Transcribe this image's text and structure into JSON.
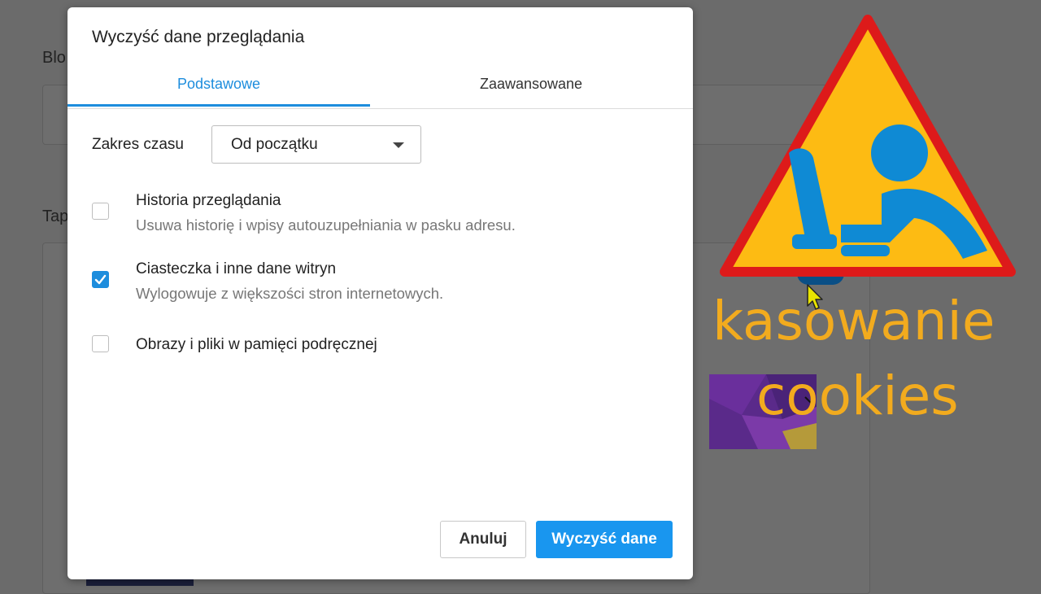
{
  "background": {
    "labels": [
      "Blo",
      "Tap"
    ]
  },
  "dialog": {
    "title": "Wyczyść dane przeglądania",
    "tabs": [
      {
        "label": "Podstawowe",
        "active": true
      },
      {
        "label": "Zaawansowane",
        "active": false
      }
    ],
    "time_range": {
      "label": "Zakres czasu",
      "selected": "Od początku"
    },
    "options": [
      {
        "title": "Historia przeglądania",
        "description": "Usuwa historię i wpisy autouzupełniania w pasku adresu.",
        "checked": false
      },
      {
        "title": "Ciasteczka i inne dane witryn",
        "description": "Wylogowuje z większości stron internetowych.",
        "checked": true
      },
      {
        "title": "Obrazy i pliki w pamięci podręcznej",
        "description": "",
        "checked": false
      }
    ],
    "buttons": {
      "cancel": "Anuluj",
      "clear": "Wyczyść dane"
    }
  },
  "overlay": {
    "line1": "kasowanie",
    "line2": "cookies",
    "text_color": "#f2ab1e",
    "sign_fill": "#fdbb13",
    "sign_border": "#dd1a1a",
    "figure_color": "#0f8ad4"
  },
  "colors": {
    "accent": "#1d8ddd",
    "button_primary": "#1996ef"
  }
}
